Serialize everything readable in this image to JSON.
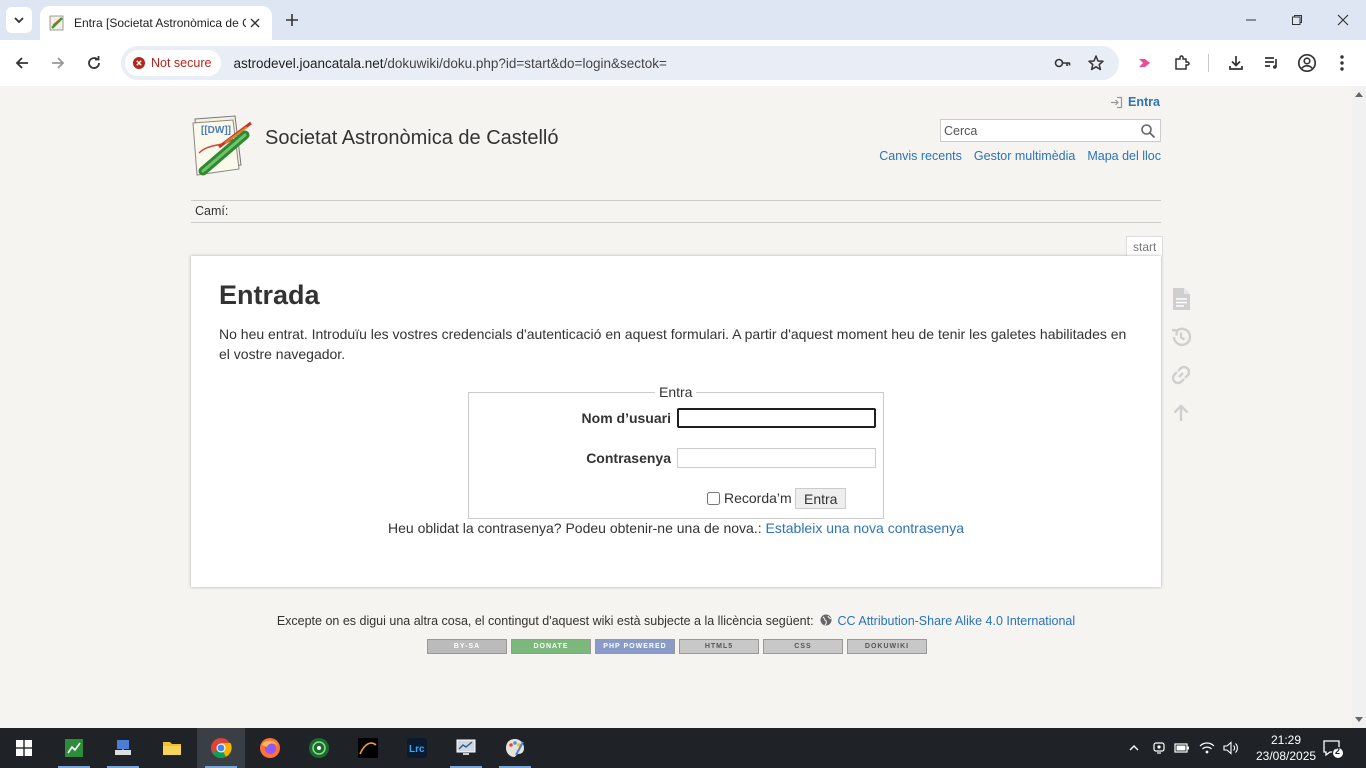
{
  "browser": {
    "tab_title": "Entra [Societat Astronòmica de Castelló]",
    "security_chip": "Not secure",
    "url_host": "astrodevel.joancatala.net",
    "url_path": "/dokuwiki/doku.php?id=start&do=login&sectok="
  },
  "header": {
    "login_link": "Entra",
    "site_title": "Societat Astronòmica de Castelló",
    "search_placeholder": "Cerca",
    "tools": [
      "Canvis recents",
      "Gestor multimèdia",
      "Mapa del lloc"
    ],
    "breadcrumb_label": "Camí:"
  },
  "page": {
    "page_id": "start",
    "heading": "Entrada",
    "intro": "No heu entrat. Introduïu les vostres credencials d'autenticació en aquest formulari. A partir d'aquest moment heu de tenir les galetes habilitades en el vostre navegador.",
    "form": {
      "legend": "Entra",
      "username_label": "Nom d’usuari",
      "username_value": "",
      "password_label": "Contrasenya",
      "password_value": "",
      "remember_label": "Recorda’m",
      "remember_checked": false,
      "submit_label": "Entra"
    },
    "resend_text": "Heu oblidat la contrasenya? Podeu obtenir-ne una de nova.:",
    "resend_link": "Estableix una nova contrasenya"
  },
  "footer": {
    "license_text": "Excepte on es digui una altra cosa, el contingut d'aquest wiki està subjecte a la llicència següent:",
    "license_link": "CC Attribution-Share Alike 4.0 International",
    "badges": [
      "BY-SA",
      "DONATE",
      "PHP POWERED",
      "HTML5",
      "CSS",
      "DOKUWIKI"
    ]
  },
  "taskbar": {
    "time": "21:29",
    "date": "23/08/2025",
    "notification_count": "2"
  },
  "icons": {
    "page_tools": [
      "document-icon",
      "history-icon",
      "backlinks-icon",
      "back-to-top-icon"
    ]
  },
  "colors": {
    "link": "#2b73b7",
    "page_bg": "#f5f4f1",
    "tab_strip": "#dfe6f3",
    "insecure": "#b3261e"
  }
}
